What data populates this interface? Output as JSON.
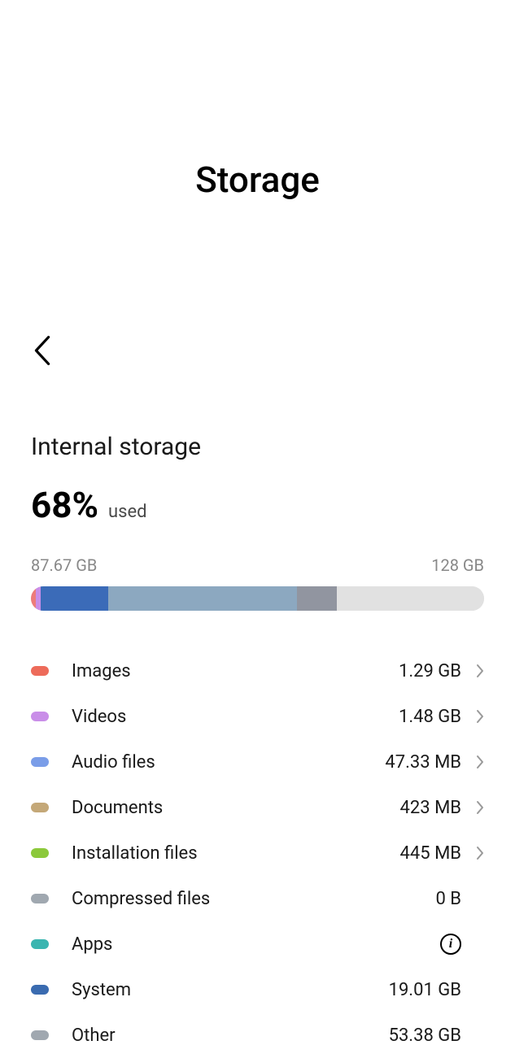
{
  "header": {
    "title": "Storage"
  },
  "storage": {
    "section_title": "Internal storage",
    "percent": "68%",
    "percent_label": "used",
    "used_size": "87.67 GB",
    "total_size": "128 GB"
  },
  "bar_segments": [
    {
      "color": "#ed7b7b",
      "width": "1.0%"
    },
    {
      "color": "#c98ee8",
      "width": "1.2%"
    },
    {
      "color": "#3b6bb8",
      "width": "14.8%"
    },
    {
      "color": "#8ca8c0",
      "width": "41.7%"
    },
    {
      "color": "#9195a0",
      "width": "8.9%"
    },
    {
      "color": "#e1e1e1",
      "width": "32.4%"
    }
  ],
  "categories": [
    {
      "label": "Images",
      "size": "1.29 GB",
      "color": "#ed6b5a",
      "chevron": true,
      "info": false
    },
    {
      "label": "Videos",
      "size": "1.48 GB",
      "color": "#c98ee8",
      "chevron": true,
      "info": false
    },
    {
      "label": "Audio files",
      "size": "47.33 MB",
      "color": "#7a9de8",
      "chevron": true,
      "info": false
    },
    {
      "label": "Documents",
      "size": "423 MB",
      "color": "#c4a878",
      "chevron": true,
      "info": false
    },
    {
      "label": "Installation files",
      "size": "445 MB",
      "color": "#8cc93b",
      "chevron": true,
      "info": false
    },
    {
      "label": "Compressed files",
      "size": "0 B",
      "color": "#a0a8b0",
      "chevron": false,
      "info": false
    },
    {
      "label": "Apps",
      "size": "",
      "color": "#3ab5b0",
      "chevron": false,
      "info": true
    },
    {
      "label": "System",
      "size": "19.01 GB",
      "color": "#3a6bb0",
      "chevron": false,
      "info": false
    },
    {
      "label": "Other",
      "size": "53.38 GB",
      "color": "#a0a8b0",
      "chevron": false,
      "info": false
    }
  ]
}
